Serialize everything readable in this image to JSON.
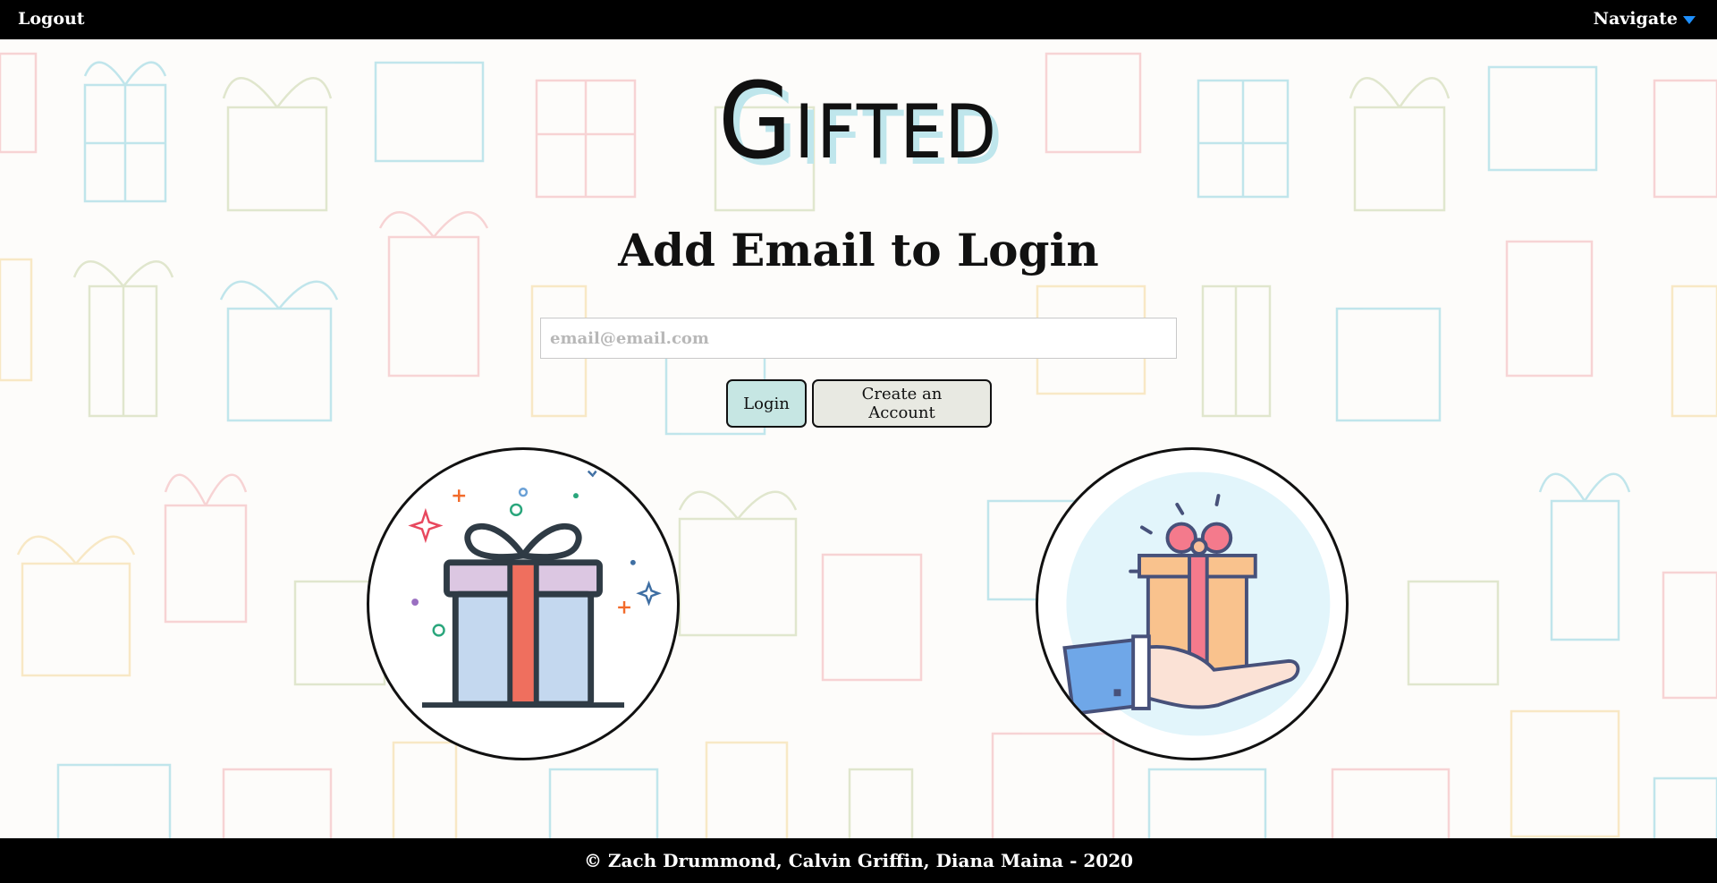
{
  "nav": {
    "logout_label": "Logout",
    "navigate_label": "Navigate"
  },
  "brand": {
    "name": "Gifted"
  },
  "login_form": {
    "heading": "Add Email to Login",
    "email_placeholder": "email@email.com",
    "login_button": "Login",
    "create_account_button": "Create an Account"
  },
  "footer": {
    "text": "© Zach Drummond, Calvin Griffin, Diana Maina - 2020"
  },
  "colors": {
    "topbar_bg": "#000000",
    "caret_accent": "#1e90ff",
    "login_button_bg": "#c6e6e3",
    "create_button_bg": "#e8e9e2",
    "brand_shadow": "#bfe6ec"
  },
  "illustrations": {
    "left": "gift-box-icon",
    "right": "hand-giving-gift-icon"
  }
}
